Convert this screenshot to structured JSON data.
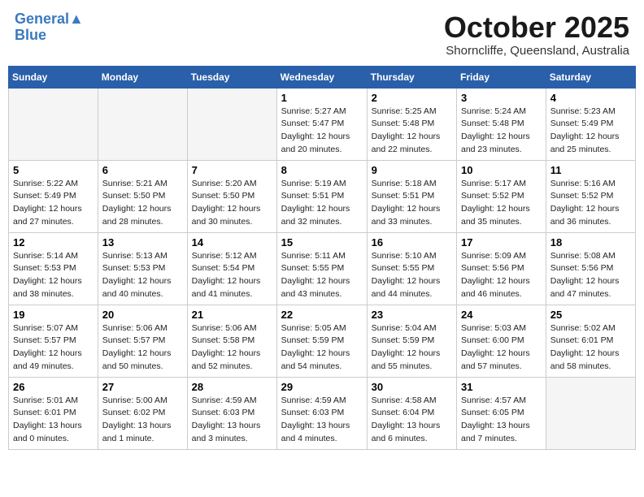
{
  "header": {
    "logo_line1": "General",
    "logo_line2": "Blue",
    "month_title": "October 2025",
    "location": "Shorncliffe, Queensland, Australia"
  },
  "days_of_week": [
    "Sunday",
    "Monday",
    "Tuesday",
    "Wednesday",
    "Thursday",
    "Friday",
    "Saturday"
  ],
  "weeks": [
    [
      {
        "day": "",
        "detail": ""
      },
      {
        "day": "",
        "detail": ""
      },
      {
        "day": "",
        "detail": ""
      },
      {
        "day": "1",
        "detail": "Sunrise: 5:27 AM\nSunset: 5:47 PM\nDaylight: 12 hours\nand 20 minutes."
      },
      {
        "day": "2",
        "detail": "Sunrise: 5:25 AM\nSunset: 5:48 PM\nDaylight: 12 hours\nand 22 minutes."
      },
      {
        "day": "3",
        "detail": "Sunrise: 5:24 AM\nSunset: 5:48 PM\nDaylight: 12 hours\nand 23 minutes."
      },
      {
        "day": "4",
        "detail": "Sunrise: 5:23 AM\nSunset: 5:49 PM\nDaylight: 12 hours\nand 25 minutes."
      }
    ],
    [
      {
        "day": "5",
        "detail": "Sunrise: 5:22 AM\nSunset: 5:49 PM\nDaylight: 12 hours\nand 27 minutes."
      },
      {
        "day": "6",
        "detail": "Sunrise: 5:21 AM\nSunset: 5:50 PM\nDaylight: 12 hours\nand 28 minutes."
      },
      {
        "day": "7",
        "detail": "Sunrise: 5:20 AM\nSunset: 5:50 PM\nDaylight: 12 hours\nand 30 minutes."
      },
      {
        "day": "8",
        "detail": "Sunrise: 5:19 AM\nSunset: 5:51 PM\nDaylight: 12 hours\nand 32 minutes."
      },
      {
        "day": "9",
        "detail": "Sunrise: 5:18 AM\nSunset: 5:51 PM\nDaylight: 12 hours\nand 33 minutes."
      },
      {
        "day": "10",
        "detail": "Sunrise: 5:17 AM\nSunset: 5:52 PM\nDaylight: 12 hours\nand 35 minutes."
      },
      {
        "day": "11",
        "detail": "Sunrise: 5:16 AM\nSunset: 5:52 PM\nDaylight: 12 hours\nand 36 minutes."
      }
    ],
    [
      {
        "day": "12",
        "detail": "Sunrise: 5:14 AM\nSunset: 5:53 PM\nDaylight: 12 hours\nand 38 minutes."
      },
      {
        "day": "13",
        "detail": "Sunrise: 5:13 AM\nSunset: 5:53 PM\nDaylight: 12 hours\nand 40 minutes."
      },
      {
        "day": "14",
        "detail": "Sunrise: 5:12 AM\nSunset: 5:54 PM\nDaylight: 12 hours\nand 41 minutes."
      },
      {
        "day": "15",
        "detail": "Sunrise: 5:11 AM\nSunset: 5:55 PM\nDaylight: 12 hours\nand 43 minutes."
      },
      {
        "day": "16",
        "detail": "Sunrise: 5:10 AM\nSunset: 5:55 PM\nDaylight: 12 hours\nand 44 minutes."
      },
      {
        "day": "17",
        "detail": "Sunrise: 5:09 AM\nSunset: 5:56 PM\nDaylight: 12 hours\nand 46 minutes."
      },
      {
        "day": "18",
        "detail": "Sunrise: 5:08 AM\nSunset: 5:56 PM\nDaylight: 12 hours\nand 47 minutes."
      }
    ],
    [
      {
        "day": "19",
        "detail": "Sunrise: 5:07 AM\nSunset: 5:57 PM\nDaylight: 12 hours\nand 49 minutes."
      },
      {
        "day": "20",
        "detail": "Sunrise: 5:06 AM\nSunset: 5:57 PM\nDaylight: 12 hours\nand 50 minutes."
      },
      {
        "day": "21",
        "detail": "Sunrise: 5:06 AM\nSunset: 5:58 PM\nDaylight: 12 hours\nand 52 minutes."
      },
      {
        "day": "22",
        "detail": "Sunrise: 5:05 AM\nSunset: 5:59 PM\nDaylight: 12 hours\nand 54 minutes."
      },
      {
        "day": "23",
        "detail": "Sunrise: 5:04 AM\nSunset: 5:59 PM\nDaylight: 12 hours\nand 55 minutes."
      },
      {
        "day": "24",
        "detail": "Sunrise: 5:03 AM\nSunset: 6:00 PM\nDaylight: 12 hours\nand 57 minutes."
      },
      {
        "day": "25",
        "detail": "Sunrise: 5:02 AM\nSunset: 6:01 PM\nDaylight: 12 hours\nand 58 minutes."
      }
    ],
    [
      {
        "day": "26",
        "detail": "Sunrise: 5:01 AM\nSunset: 6:01 PM\nDaylight: 13 hours\nand 0 minutes."
      },
      {
        "day": "27",
        "detail": "Sunrise: 5:00 AM\nSunset: 6:02 PM\nDaylight: 13 hours\nand 1 minute."
      },
      {
        "day": "28",
        "detail": "Sunrise: 4:59 AM\nSunset: 6:03 PM\nDaylight: 13 hours\nand 3 minutes."
      },
      {
        "day": "29",
        "detail": "Sunrise: 4:59 AM\nSunset: 6:03 PM\nDaylight: 13 hours\nand 4 minutes."
      },
      {
        "day": "30",
        "detail": "Sunrise: 4:58 AM\nSunset: 6:04 PM\nDaylight: 13 hours\nand 6 minutes."
      },
      {
        "day": "31",
        "detail": "Sunrise: 4:57 AM\nSunset: 6:05 PM\nDaylight: 13 hours\nand 7 minutes."
      },
      {
        "day": "",
        "detail": ""
      }
    ]
  ]
}
